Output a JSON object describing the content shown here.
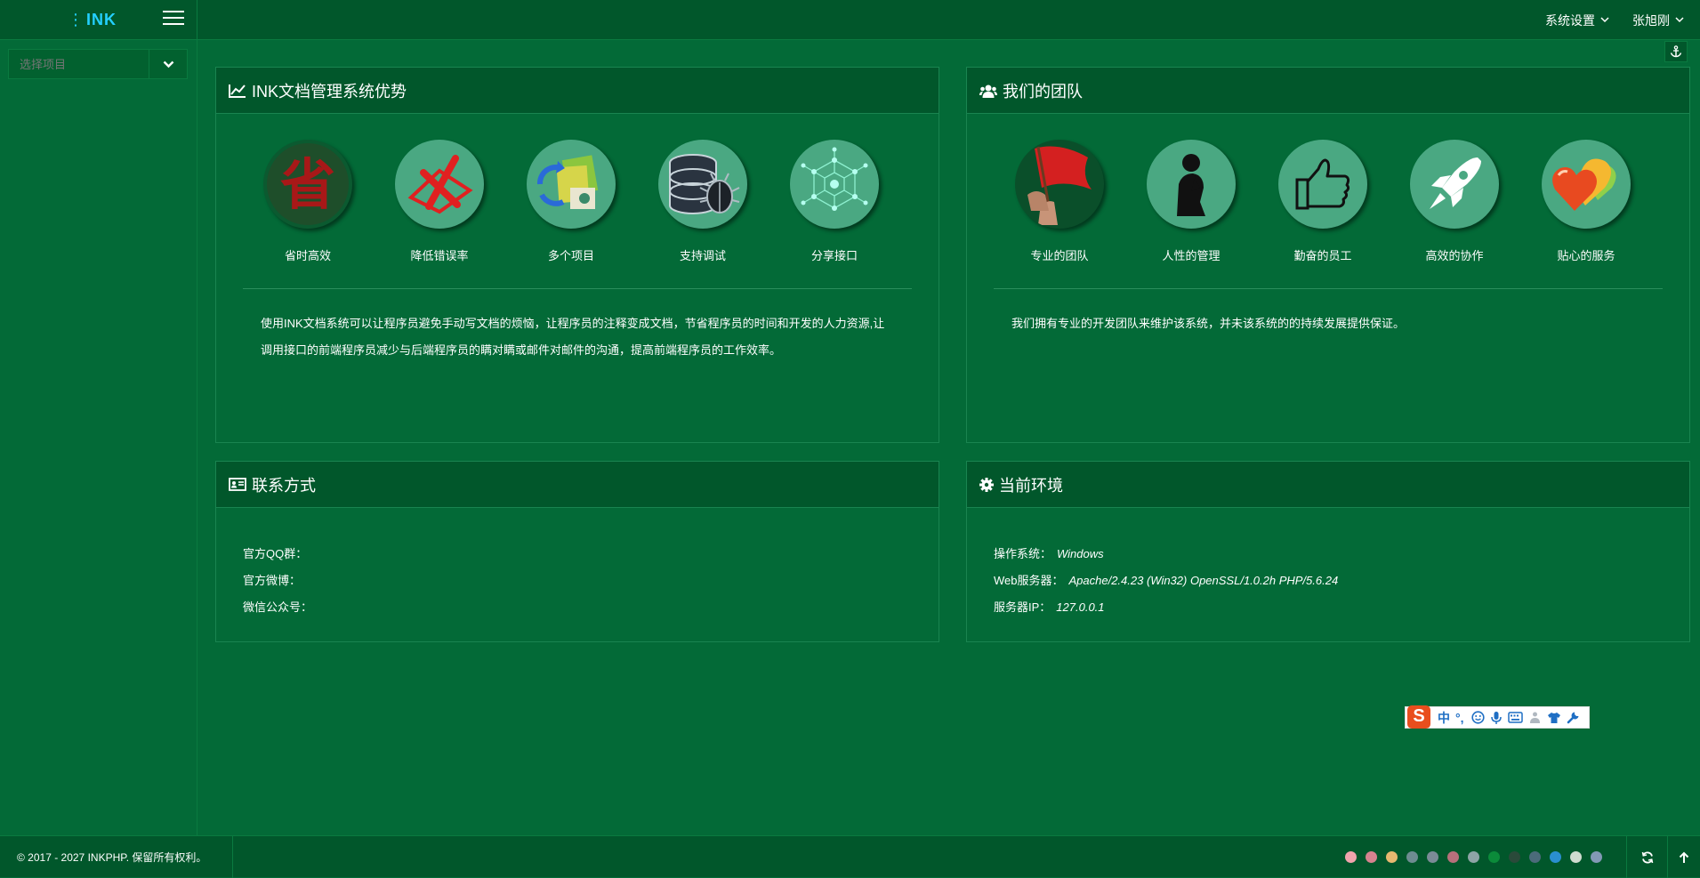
{
  "app": {
    "logo_dots": "⋮",
    "logo_text": "INK"
  },
  "topnav": {
    "settings_label": "系统设置",
    "user_label": "张旭刚"
  },
  "sidebar": {
    "select_placeholder": "选择项目"
  },
  "panels": {
    "advantages": {
      "title": "INK文档管理系统优势",
      "icons": [
        {
          "label": "省时高效",
          "icon": "seal-character-icon"
        },
        {
          "label": "降低错误率",
          "icon": "red-cross-icon"
        },
        {
          "label": "多个项目",
          "icon": "folders-sync-icon"
        },
        {
          "label": "支持调试",
          "icon": "database-bug-icon"
        },
        {
          "label": "分享接口",
          "icon": "network-nodes-icon"
        }
      ],
      "description": "使用INK文档系统可以让程序员避免手动写文档的烦恼，让程序员的注释变成文档，节省程序员的时间和开发的人力资源,让调用接口的前端程序员减少与后端程序员的瞒对瞒或邮件对邮件的沟通，提高前端程序员的工作效率。"
    },
    "team": {
      "title": "我们的团队",
      "icons": [
        {
          "label": "专业的团队",
          "icon": "red-flag-icon"
        },
        {
          "label": "人性的管理",
          "icon": "thinker-silhouette-icon"
        },
        {
          "label": "勤奋的员工",
          "icon": "thumbs-up-icon"
        },
        {
          "label": "高效的协作",
          "icon": "rocket-icon"
        },
        {
          "label": "贴心的服务",
          "icon": "hearts-icon"
        }
      ],
      "description": "我们拥有专业的开发团队来维护该系统，并未该系统的的持续发展提供保证。"
    },
    "contact": {
      "title": "联系方式",
      "qq_label": "官方QQ群：",
      "weibo_label": "官方微博：",
      "wechat_label": "微信公众号："
    },
    "env": {
      "title": "当前环境",
      "os_label": "操作系统：",
      "os_value": "Windows",
      "web_label": "Web服务器：",
      "web_value": "Apache/2.4.23 (Win32) OpenSSL/1.0.2h PHP/5.6.24",
      "ip_label": "服务器IP：",
      "ip_value": "127.0.0.1"
    }
  },
  "ime": {
    "chinese": "中",
    "punct": "°,"
  },
  "footer": {
    "copyright": "© 2017 - 2027 INKPHP. 保留所有权利。",
    "theme_colors": [
      "#f0a4ad",
      "#d6838f",
      "#e8b870",
      "#6e8c91",
      "#7b8b97",
      "#b7707b",
      "#8ea4a6",
      "#0b8b3a",
      "#2a4a3a",
      "#4b6b7a",
      "#2a8fd0",
      "#cfdcd0",
      "#8299b5"
    ]
  },
  "colors": {
    "page_bg": "#036a37",
    "header_bg": "#01572b",
    "accent": "#24d0ff"
  }
}
